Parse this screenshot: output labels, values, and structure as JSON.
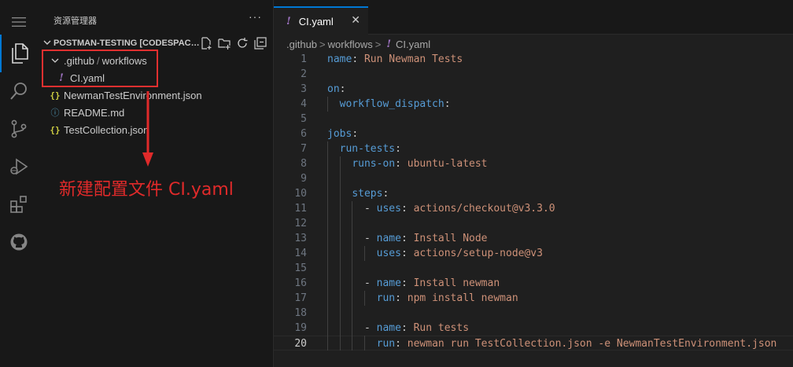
{
  "activity_bar": {
    "items": [
      {
        "name": "menu-icon"
      },
      {
        "name": "explorer-icon",
        "active": true
      },
      {
        "name": "search-icon"
      },
      {
        "name": "source-control-icon"
      },
      {
        "name": "run-debug-icon"
      },
      {
        "name": "extensions-icon"
      },
      {
        "name": "github-icon"
      }
    ]
  },
  "sidebar": {
    "title": "资源管理器",
    "more": "···",
    "project_name": "POSTMAN-TESTING [CODESPACES]",
    "tree": {
      "folder": ".github",
      "folder_sep": "/",
      "subfolder": "workflows",
      "files": [
        {
          "name": "CI.yaml",
          "icon": "!"
        },
        {
          "name": "NewmanTestEnvironment.json",
          "icon": "{}"
        },
        {
          "name": "README.md",
          "icon": "ⓘ"
        },
        {
          "name": "TestCollection.json",
          "icon": "{}"
        }
      ]
    }
  },
  "annotation": {
    "text": "新建配置文件 CI.yaml",
    "color": "#e02a2a"
  },
  "editor": {
    "tab": {
      "icon": "!",
      "label": "CI.yaml",
      "close": "✕"
    },
    "breadcrumb": {
      "seg1": ".github",
      "seg2": "workflows",
      "sep": ">",
      "icon": "!",
      "file": "CI.yaml"
    },
    "current_line": 20,
    "lines": [
      {
        "n": "1",
        "key": "name",
        "val": "Run Newman Tests",
        "indent": "",
        "dash": ""
      },
      {
        "n": "2",
        "key": "",
        "val": "",
        "indent": "",
        "dash": ""
      },
      {
        "n": "3",
        "key": "on",
        "val": "",
        "indent": "",
        "dash": ""
      },
      {
        "n": "4",
        "key": "workflow_dispatch",
        "val": "",
        "indent": "  ",
        "dash": ""
      },
      {
        "n": "5",
        "key": "",
        "val": "",
        "indent": "",
        "dash": ""
      },
      {
        "n": "6",
        "key": "jobs",
        "val": "",
        "indent": "",
        "dash": ""
      },
      {
        "n": "7",
        "key": "run-tests",
        "val": "",
        "indent": "  ",
        "dash": ""
      },
      {
        "n": "8",
        "key": "runs-on",
        "val": "ubuntu-latest",
        "indent": "    ",
        "dash": ""
      },
      {
        "n": "9",
        "key": "",
        "val": "",
        "indent": "",
        "dash": ""
      },
      {
        "n": "10",
        "key": "steps",
        "val": "",
        "indent": "    ",
        "dash": ""
      },
      {
        "n": "11",
        "key": "uses",
        "val": "actions/checkout@v3.3.0",
        "indent": "      ",
        "dash": "- "
      },
      {
        "n": "12",
        "key": "",
        "val": "",
        "indent": "",
        "dash": ""
      },
      {
        "n": "13",
        "key": "name",
        "val": "Install Node",
        "indent": "      ",
        "dash": "- "
      },
      {
        "n": "14",
        "key": "uses",
        "val": "actions/setup-node@v3",
        "indent": "        ",
        "dash": ""
      },
      {
        "n": "15",
        "key": "",
        "val": "",
        "indent": "",
        "dash": ""
      },
      {
        "n": "16",
        "key": "name",
        "val": "Install newman",
        "indent": "      ",
        "dash": "- "
      },
      {
        "n": "17",
        "key": "run",
        "val": "npm install newman",
        "indent": "        ",
        "dash": ""
      },
      {
        "n": "18",
        "key": "",
        "val": "",
        "indent": "",
        "dash": ""
      },
      {
        "n": "19",
        "key": "name",
        "val": "Run tests",
        "indent": "      ",
        "dash": "- "
      },
      {
        "n": "20",
        "key": "run",
        "val": "newman run TestCollection.json -e NewmanTestEnvironment.json",
        "indent": "        ",
        "dash": ""
      }
    ]
  }
}
